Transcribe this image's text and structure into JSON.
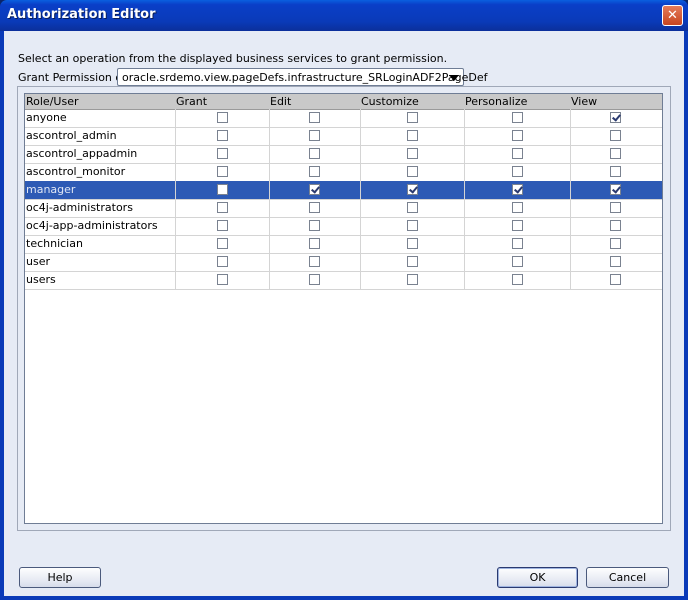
{
  "window": {
    "title": "Authorization Editor",
    "close_symbol": "✕"
  },
  "instruction": "Select an operation from the displayed business services to grant permission.",
  "grant_permission": {
    "label": "Grant Permission on:",
    "selected": "oracle.srdemo.view.pageDefs.infrastructure_SRLoginADF2PageDef"
  },
  "table": {
    "columns": [
      "Role/User",
      "Grant",
      "Edit",
      "Customize",
      "Personalize",
      "View"
    ],
    "rows": [
      {
        "name": "anyone",
        "perms": [
          false,
          false,
          false,
          false,
          true
        ]
      },
      {
        "name": "ascontrol_admin",
        "perms": [
          false,
          false,
          false,
          false,
          false
        ]
      },
      {
        "name": "ascontrol_appadmin",
        "perms": [
          false,
          false,
          false,
          false,
          false
        ]
      },
      {
        "name": "ascontrol_monitor",
        "perms": [
          false,
          false,
          false,
          false,
          false
        ]
      },
      {
        "name": "manager",
        "perms": [
          false,
          true,
          true,
          true,
          true
        ],
        "selected": true
      },
      {
        "name": "oc4j-administrators",
        "perms": [
          false,
          false,
          false,
          false,
          false
        ]
      },
      {
        "name": "oc4j-app-administrators",
        "perms": [
          false,
          false,
          false,
          false,
          false
        ]
      },
      {
        "name": "technician",
        "perms": [
          false,
          false,
          false,
          false,
          false
        ]
      },
      {
        "name": "user",
        "perms": [
          false,
          false,
          false,
          false,
          false
        ]
      },
      {
        "name": "users",
        "perms": [
          false,
          false,
          false,
          false,
          false
        ]
      }
    ]
  },
  "buttons": {
    "help": "Help",
    "ok": "OK",
    "cancel": "Cancel"
  }
}
